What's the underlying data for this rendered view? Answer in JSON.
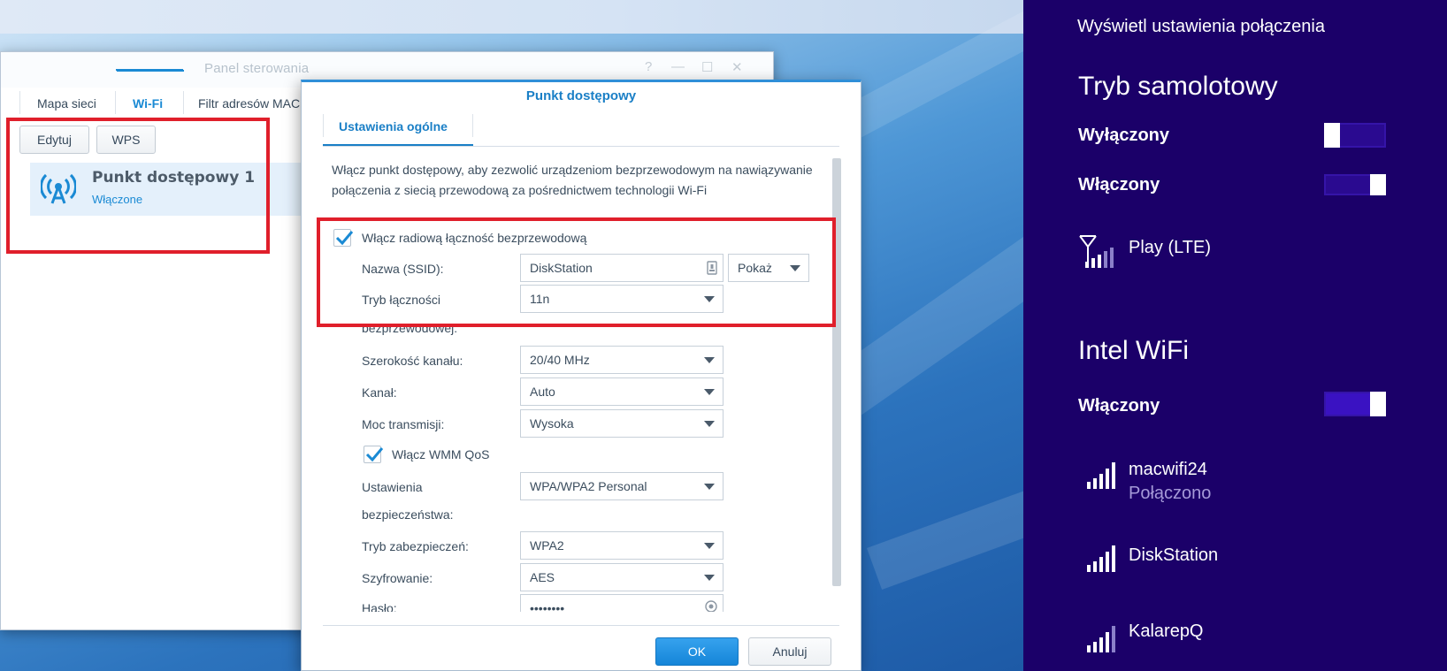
{
  "control_panel": {
    "title": "Panel sterowania",
    "window_controls": [
      "?",
      "—",
      "☐",
      "✕"
    ],
    "tabs": [
      "Mapa sieci",
      "Wi-Fi",
      "Filtr adresów MAC"
    ],
    "active_tab": "Wi-Fi",
    "buttons": {
      "edit": "Edytuj",
      "wps": "WPS"
    },
    "access_point": {
      "name": "Punkt dostępowy 1",
      "status": "Włączone",
      "icon": "wireless-antenna-icon"
    }
  },
  "dialog": {
    "title": "Punkt dostępowy",
    "tab": "Ustawienia ogólne",
    "description": "Włącz punkt dostępowy, aby zezwolić urządzeniom bezprzewodowym na nawiązywanie połączenia z siecią przewodową za pośrednictwem technologii Wi-Fi",
    "enable_radio": {
      "label": "Włącz radiową łączność bezprzewodową",
      "checked": true
    },
    "fields": {
      "ssid": {
        "label": "Nazwa (SSID):",
        "value": "DiskStation",
        "show_button": "Pokaż"
      },
      "mode": {
        "label_line1": "Tryb łączności",
        "label_line2": "bezprzewodowej:",
        "value": "11n"
      },
      "channel_width": {
        "label": "Szerokość kanału:",
        "value": "20/40 MHz"
      },
      "channel": {
        "label": "Kanał:",
        "value": "Auto"
      },
      "tx_power": {
        "label": "Moc transmisji:",
        "value": "Wysoka"
      },
      "wmm": {
        "label": "Włącz WMM QoS",
        "checked": true
      },
      "security": {
        "label_line1": "Ustawienia",
        "label_line2": "bezpieczeństwa:",
        "value": "WPA/WPA2 Personal"
      },
      "security_mode": {
        "label": "Tryb zabezpieczeń:",
        "value": "WPA2"
      },
      "encryption": {
        "label": "Szyfrowanie:",
        "value": "AES"
      },
      "password": {
        "label": "Hasło:",
        "value": "••••••••"
      }
    },
    "buttons": {
      "ok": "OK",
      "cancel": "Anuluj"
    }
  },
  "charm": {
    "header": "Wyświetl ustawienia połączenia",
    "airplane": {
      "title": "Tryb samolotowy",
      "off_label": "Wyłączony",
      "on_label": "Włączony"
    },
    "mobile": {
      "name": "Play (LTE)",
      "icon": "cellular-signal-icon"
    },
    "wifi": {
      "title": "Intel WiFi",
      "state_label": "Włączony",
      "networks": [
        {
          "name": "macwifi24",
          "status": "Połączono",
          "icon": "wifi-signal-icon"
        },
        {
          "name": "DiskStation",
          "status": "",
          "icon": "wifi-signal-icon"
        },
        {
          "name": "KalarepQ",
          "status": "",
          "icon": "wifi-signal-icon"
        }
      ]
    }
  },
  "colors": {
    "charm_bg": "#1b0069",
    "accent_blue": "#1a8ad4",
    "highlight_red": "#e01f2b",
    "toggle_on": "#3a12c2"
  }
}
